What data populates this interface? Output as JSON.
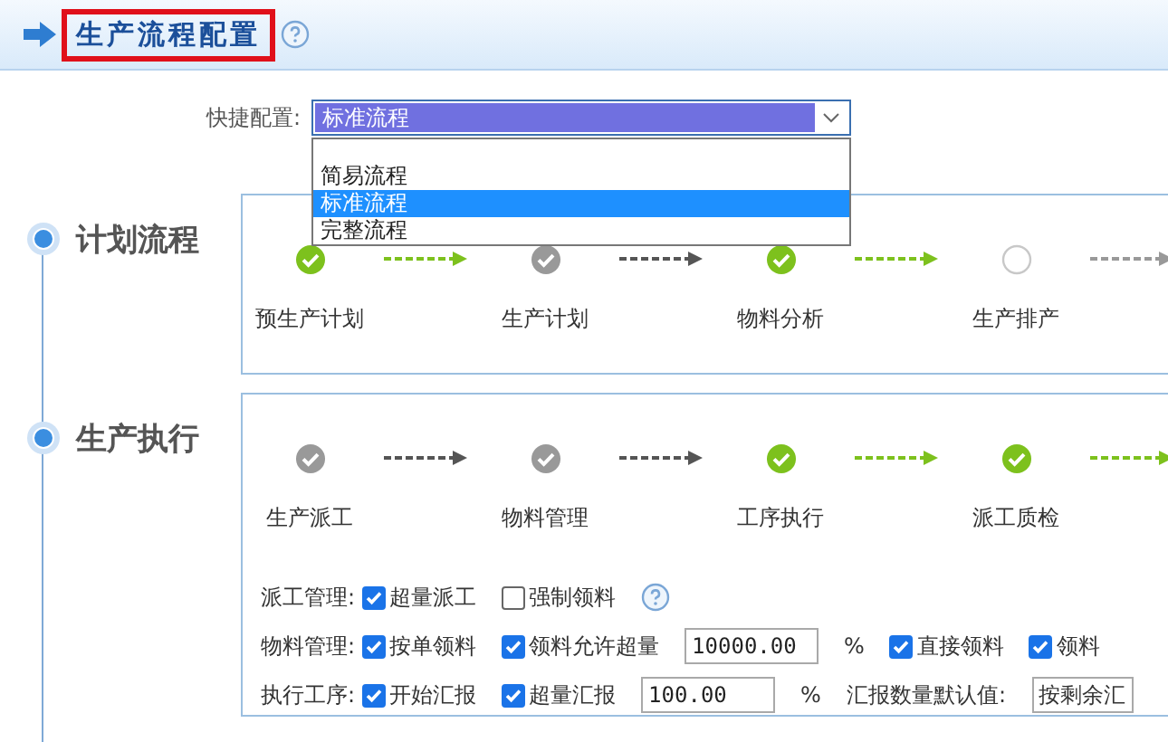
{
  "header": {
    "title": "生产流程配置"
  },
  "quick_config": {
    "label": "快捷配置:",
    "value": "标准流程",
    "expanded": true,
    "options": [
      {
        "label": "简易流程",
        "selected": false
      },
      {
        "label": "标准流程",
        "selected": true
      },
      {
        "label": "完整流程",
        "selected": false
      }
    ]
  },
  "sections": [
    {
      "title": "计划流程",
      "steps": [
        {
          "label": "预生产计划",
          "kind": "current"
        },
        {
          "label": "生产计划",
          "kind": "done"
        },
        {
          "label": "物料分析",
          "kind": "current"
        },
        {
          "label": "生产排产",
          "kind": "pending"
        }
      ]
    },
    {
      "title": "生产执行",
      "steps": [
        {
          "label": "生产派工",
          "kind": "done"
        },
        {
          "label": "物料管理",
          "kind": "done"
        },
        {
          "label": "工序执行",
          "kind": "current"
        },
        {
          "label": "派工质检",
          "kind": "current"
        }
      ],
      "settings": [
        {
          "label": "派工管理:",
          "items": [
            {
              "kind": "checkbox",
              "label": "超量派工",
              "checked": true
            },
            {
              "kind": "checkbox",
              "label": "强制领料",
              "checked": false
            },
            {
              "kind": "help"
            }
          ]
        },
        {
          "label": "物料管理:",
          "items": [
            {
              "kind": "checkbox",
              "label": "按单领料",
              "checked": true
            },
            {
              "kind": "checkbox",
              "label": "领料允许超量",
              "checked": true
            },
            {
              "kind": "input",
              "value": "10000.00"
            },
            {
              "kind": "text",
              "text": "%"
            },
            {
              "kind": "checkbox",
              "label": "直接领料",
              "checked": true
            },
            {
              "kind": "checkbox",
              "label": "领料",
              "checked": true
            }
          ]
        },
        {
          "label": "执行工序:",
          "items": [
            {
              "kind": "checkbox",
              "label": "开始汇报",
              "checked": true
            },
            {
              "kind": "checkbox",
              "label": "超量汇报",
              "checked": true
            },
            {
              "kind": "input",
              "value": "100.00"
            },
            {
              "kind": "text",
              "text": "%"
            },
            {
              "kind": "text",
              "text": "汇报数量默认值:"
            },
            {
              "kind": "select",
              "value": "按剩余汇"
            }
          ]
        }
      ]
    }
  ]
}
